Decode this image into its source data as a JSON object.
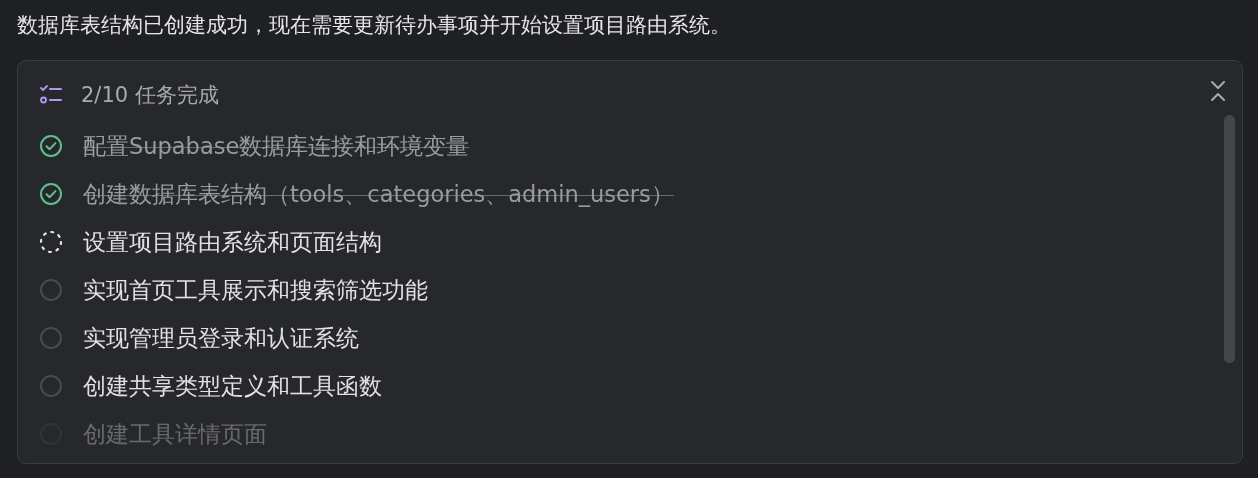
{
  "message": "数据库表结构已创建成功，现在需要更新待办事项并开始设置项目路由系统。",
  "todo": {
    "summary": "2/10 任务完成",
    "items": [
      {
        "text": "配置Supabase数据库连接和环境变量",
        "kind": "done",
        "faded": false
      },
      {
        "text": "创建数据库表结构（tools、categories、admin_users）",
        "kind": "done",
        "faded": false
      },
      {
        "text": "设置项目路由系统和页面结构",
        "kind": "active",
        "faded": false
      },
      {
        "text": "实现首页工具展示和搜索筛选功能",
        "kind": "pending",
        "faded": false
      },
      {
        "text": "实现管理员登录和认证系统",
        "kind": "pending",
        "faded": false
      },
      {
        "text": "创建共享类型定义和工具函数",
        "kind": "pending",
        "faded": false
      },
      {
        "text": "创建工具详情页面",
        "kind": "pending",
        "faded": true
      }
    ]
  }
}
